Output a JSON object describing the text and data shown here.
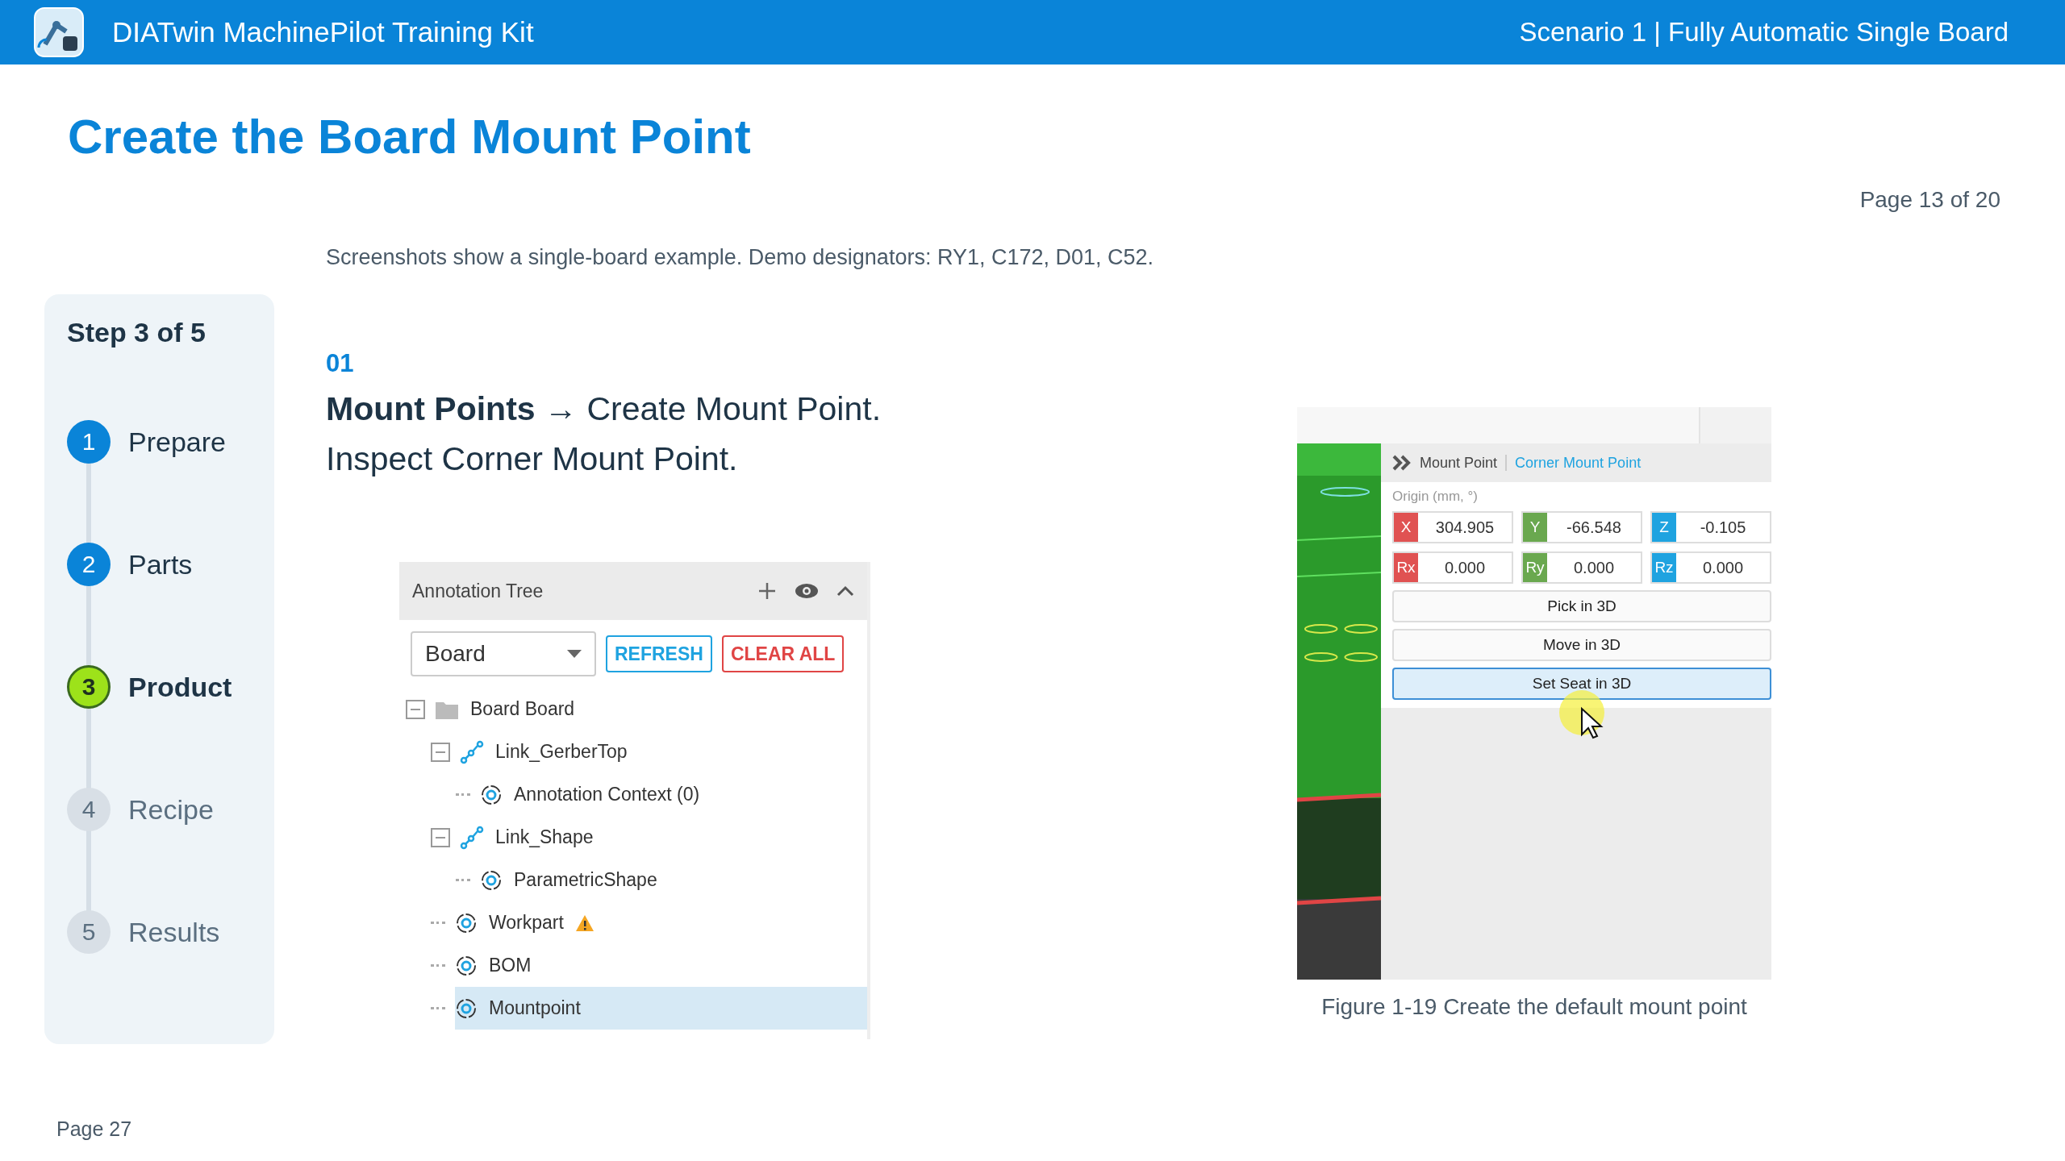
{
  "header": {
    "title": "DIATwin MachinePilot Training Kit",
    "scenario": "Scenario 1 | Fully Automatic Single Board"
  },
  "page_title": "Create the Board Mount Point",
  "page_counter": "Page 13 of 20",
  "subtitle": "Screenshots show a single-board example. Demo designators: RY1, C172, D01, C52.",
  "stepper": {
    "title": "Step 3 of 5",
    "steps": [
      {
        "number": "1",
        "label": "Prepare",
        "kind": "done"
      },
      {
        "number": "2",
        "label": "Parts",
        "kind": "done"
      },
      {
        "number": "3",
        "label": "Product",
        "kind": "current"
      },
      {
        "number": "4",
        "label": "Recipe",
        "kind": "todo"
      },
      {
        "number": "5",
        "label": "Results",
        "kind": "todo"
      }
    ]
  },
  "step": {
    "number": "01",
    "lines": [
      "**Mount Points** → Create Mount Point.",
      "Inspect Corner Mount Point."
    ]
  },
  "annotation_tree": {
    "title": "Annotation Tree",
    "dropdown": {
      "value": "Board"
    },
    "buttons": [
      {
        "label": "REFRESH",
        "kind": "primary"
      },
      {
        "label": "CLEAR ALL",
        "kind": "danger"
      }
    ],
    "items": [
      {
        "label": "Board  Board",
        "kind": "folder",
        "expanded": true,
        "selected": false,
        "children": [
          {
            "label": "Link_GerberTop",
            "kind": "link",
            "expanded": true,
            "selected": false,
            "children": [
              {
                "label": "Annotation Context (0)",
                "kind": "target",
                "selected": false
              }
            ]
          },
          {
            "label": "Link_Shape",
            "kind": "link",
            "expanded": true,
            "selected": false,
            "children": [
              {
                "label": "ParametricShape",
                "kind": "target",
                "selected": false
              }
            ]
          },
          {
            "label": "Workpart",
            "kind": "target",
            "warning": true,
            "selected": false
          },
          {
            "label": "BOM",
            "kind": "target",
            "selected": false
          },
          {
            "label": "Mountpoint",
            "kind": "target",
            "selected": true
          }
        ]
      }
    ]
  },
  "figure": {
    "breadcrumb": [
      "Mount Point",
      "Corner Mount Point"
    ],
    "origin_label": "Origin (mm, °)",
    "coordinates": [
      {
        "axis": "X",
        "value": "304.905",
        "color": "#e05252"
      },
      {
        "axis": "Y",
        "value": "-66.548",
        "color": "#6aa84f"
      },
      {
        "axis": "Z",
        "value": "-0.105",
        "color": "#1fa3e0"
      },
      {
        "axis": "Rx",
        "value": "0.000",
        "color": "#e05252"
      },
      {
        "axis": "Ry",
        "value": "0.000",
        "color": "#6aa84f"
      },
      {
        "axis": "Rz",
        "value": "0.000",
        "color": "#1fa3e0"
      }
    ],
    "actions": [
      {
        "label": "Pick in 3D",
        "selected": false
      },
      {
        "label": "Move in 3D",
        "selected": false
      },
      {
        "label": "Set Seat in 3D",
        "selected": true
      }
    ],
    "caption": "Figure 1-19  Create the default mount point"
  },
  "footer": "Page 27"
}
